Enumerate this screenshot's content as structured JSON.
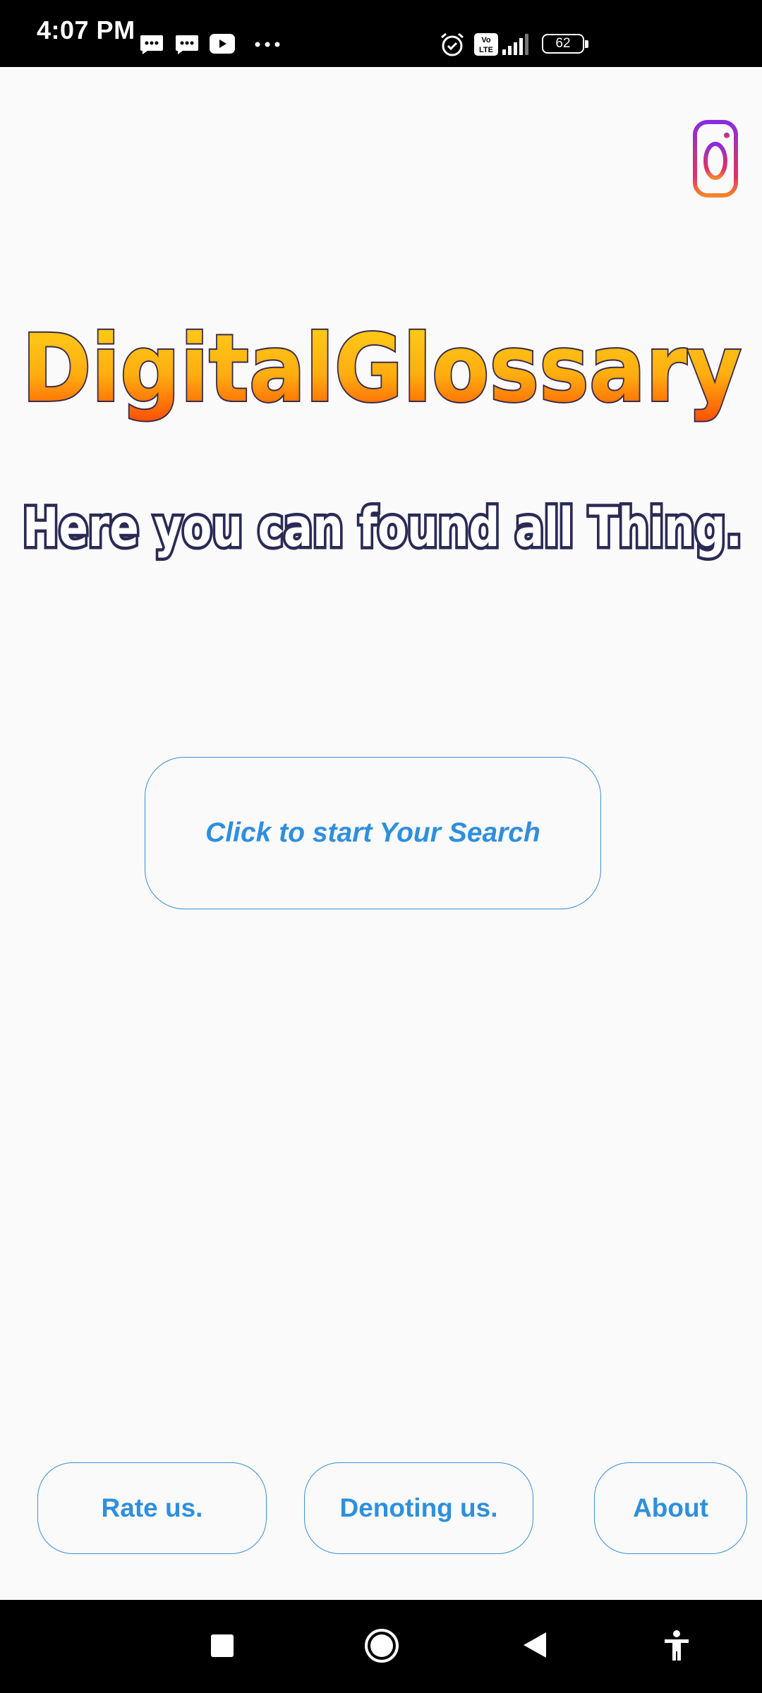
{
  "status_bar": {
    "time": "4:07 PM",
    "battery": "62",
    "notification_icons": [
      "message-icon",
      "message-icon",
      "youtube-icon",
      "more-dots-icon"
    ],
    "system_icons": [
      "alarm-icon",
      "volte-icon",
      "signal-icon",
      "battery-icon"
    ]
  },
  "header": {
    "title": "DigitalGlossary",
    "subtitle": "Here you can found all Thing."
  },
  "main": {
    "search_label": "Click to start Your Search"
  },
  "footer": {
    "rate_label": "Rate us.",
    "donate_label": "Denoting us.",
    "about_label": "About"
  },
  "nav_bar": {
    "icons": [
      "recents-icon",
      "home-icon",
      "back-icon",
      "accessibility-icon"
    ]
  },
  "colors": {
    "accent": "#2f8fdd",
    "title_top": "#ffd21a",
    "title_bottom": "#ff5a00",
    "title_outline": "#3a2a4a",
    "subtitle_fill": "#ffffff",
    "subtitle_outline": "#2a2a55"
  }
}
